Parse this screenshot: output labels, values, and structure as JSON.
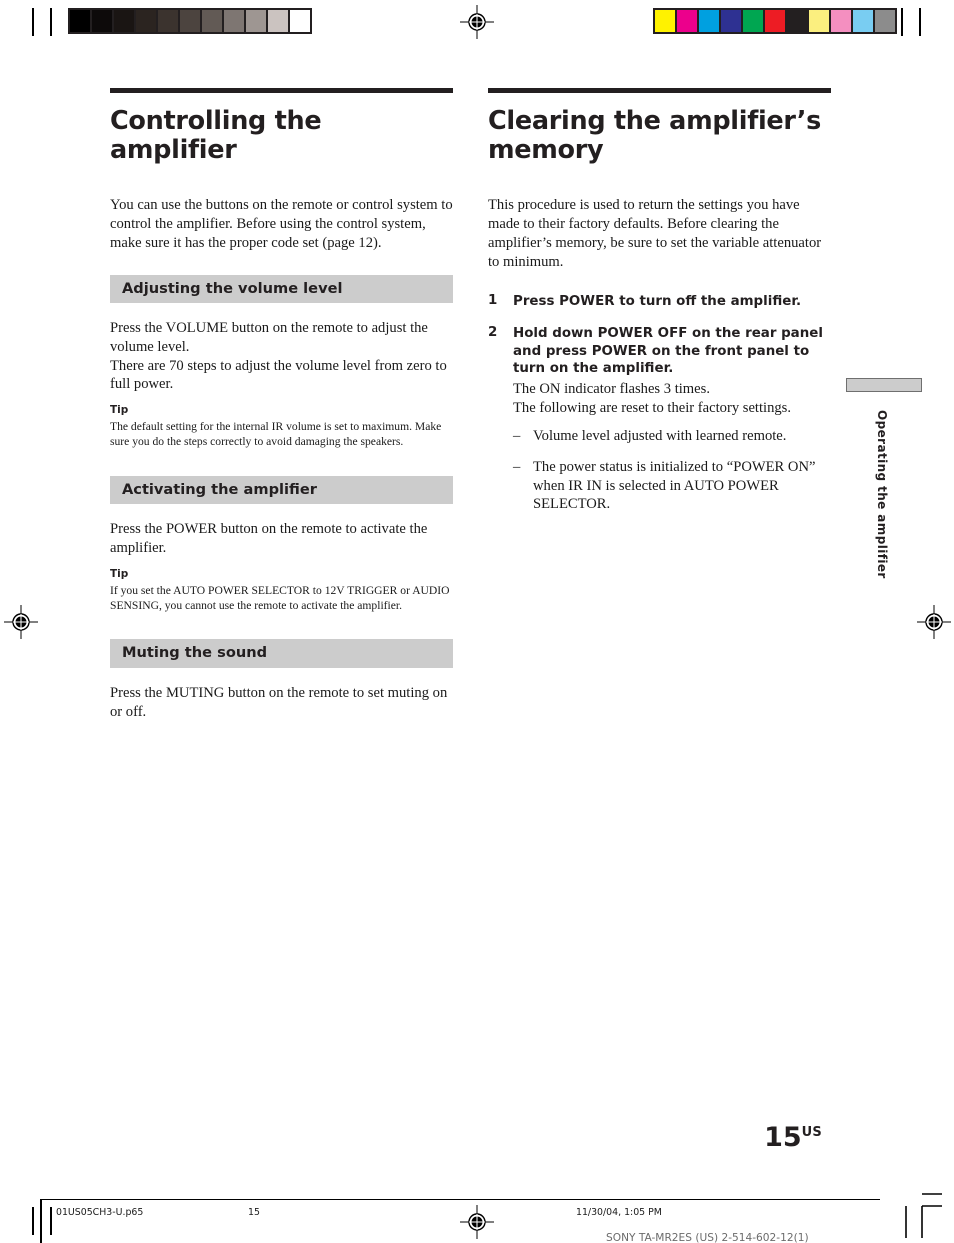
{
  "document": {
    "page_number": "15",
    "page_number_suffix": "US",
    "side_tab_label": "Operating the amplifier"
  },
  "left_column": {
    "title": "Controlling the amplifier",
    "intro": "You can use the buttons on the remote or control system to control the amplifier. Before using the control system, make sure it has the proper code set (page 12).",
    "sections": [
      {
        "heading": "Adjusting the volume level",
        "body": "Press the VOLUME button on the remote to adjust the volume level.\nThere are 70 steps to adjust the volume level from zero to full power.",
        "tip_label": "Tip",
        "tip_body": "The default setting for the internal IR volume is set to maximum. Make sure you do the steps correctly to avoid damaging the speakers."
      },
      {
        "heading": "Activating the amplifier",
        "body": "Press the POWER button on the remote to activate the amplifier.",
        "tip_label": "Tip",
        "tip_body": "If you set the AUTO POWER SELECTOR to 12V TRIGGER or AUDIO SENSING, you cannot use the remote to activate the amplifier."
      },
      {
        "heading": "Muting the sound",
        "body": "Press the MUTING button on the remote to set muting on or off.",
        "tip_label": "",
        "tip_body": ""
      }
    ]
  },
  "right_column": {
    "title": "Clearing the amplifier’s memory",
    "intro": "This procedure is used to return the settings you have made to their factory defaults. Before clearing the amplifier’s memory, be sure to set the variable attenuator to minimum.",
    "steps": [
      {
        "number": "1",
        "heading": "Press POWER to turn off the amplifier.",
        "detail": ""
      },
      {
        "number": "2",
        "heading": "Hold down POWER OFF on the rear panel and press POWER on the front panel to turn on the amplifier.",
        "detail": "The ON indicator flashes 3 times.\nThe following are reset to their factory settings."
      }
    ],
    "reset_items": [
      "Volume level adjusted with learned remote.",
      "The power status is initialized to “POWER ON” when IR IN is selected in AUTO POWER SELECTOR."
    ],
    "dash": "–"
  },
  "footer": {
    "file_name": "01US05CH3-U.p65",
    "page_label": "15",
    "timestamp": "11/30/04, 1:05 PM",
    "model_line": "SONY TA-MR2ES (US) 2-514-602-12(1)"
  },
  "print_marks": {
    "grayscale_patches": [
      "#000000",
      "#0d0a0a",
      "#1a1513",
      "#2b2420",
      "#3b332e",
      "#4c443f",
      "#625a55",
      "#7e7672",
      "#9e9692",
      "#cbc3c0",
      "#ffffff"
    ],
    "color_patches": [
      "#fff200",
      "#ec008c",
      "#00a0e0",
      "#2e3192",
      "#00a651",
      "#ed1c24",
      "#231f20",
      "#fbef7f",
      "#f48fc0",
      "#79cdf2",
      "#8c8c8c"
    ]
  }
}
